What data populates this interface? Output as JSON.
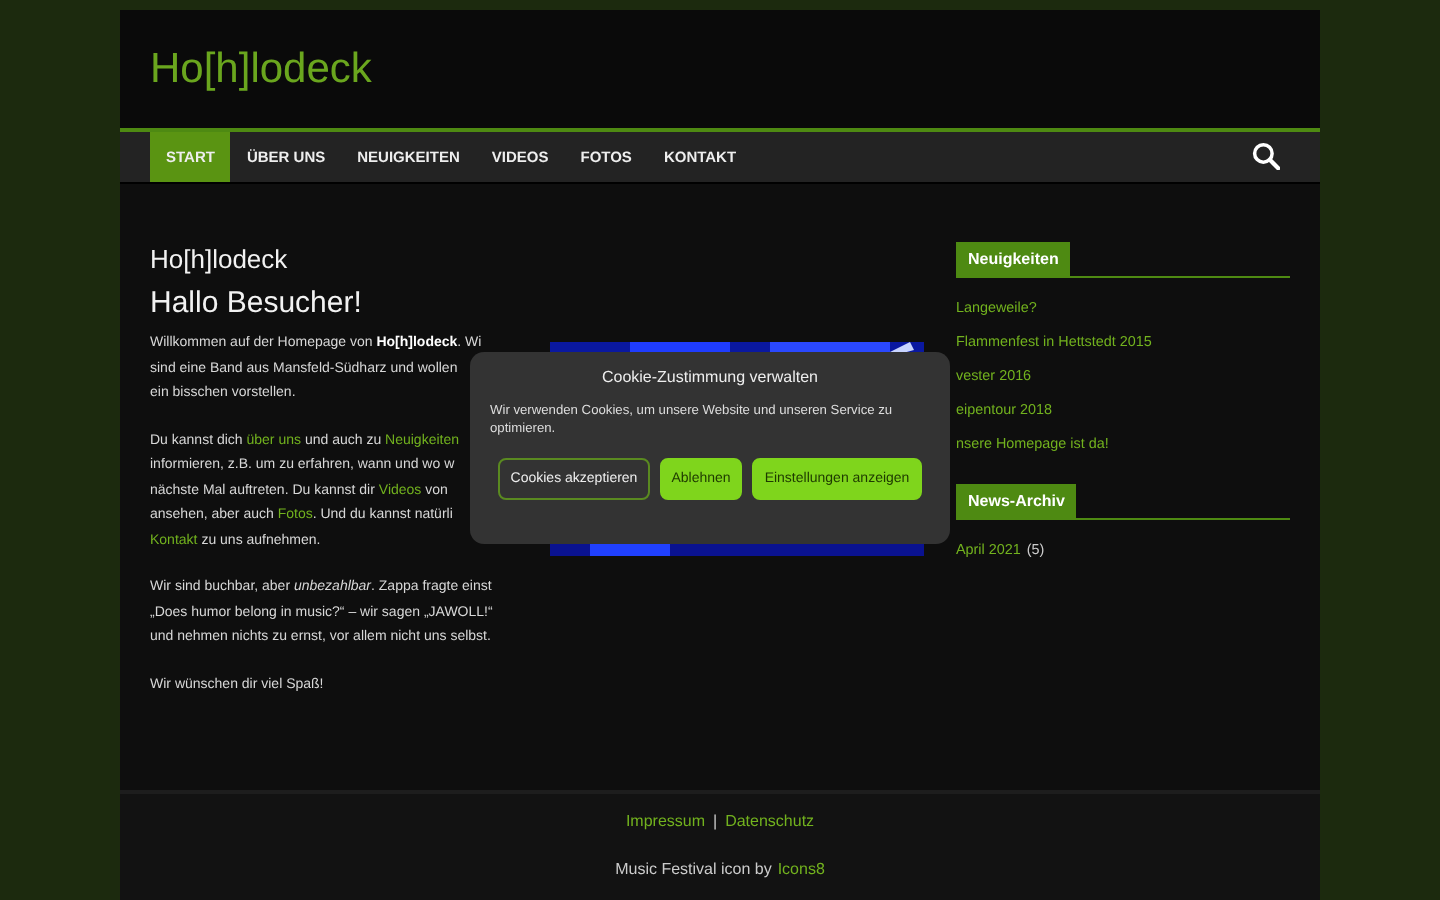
{
  "site_title": "Ho[h]lodeck",
  "nav": {
    "items": [
      {
        "label": "START",
        "selected": true
      },
      {
        "label": "ÜBER UNS",
        "selected": false
      },
      {
        "label": "NEUIGKEITEN",
        "selected": false
      },
      {
        "label": "VIDEOS",
        "selected": false
      },
      {
        "label": "FOTOS",
        "selected": false
      },
      {
        "label": "KONTAKT",
        "selected": false
      }
    ]
  },
  "page_title": "Ho[h]lodeck",
  "heading": "Hallo Besucher!",
  "paragraphs": [
    [
      [
        {
          "text": "Willkommen auf der Homepage von **Ho[h]lodeck**. Wi"
        }
      ],
      [
        {
          "text": "sind eine Band aus Mansfeld-Südharz und wollen"
        }
      ],
      [
        {
          "text": "ein bisschen vorstellen."
        }
      ]
    ],
    [
      [
        {
          "text": "Du kannst dich "
        },
        {
          "text": "über uns",
          "link": true
        },
        {
          "text": " und auch zu "
        },
        {
          "text": "Neuigkeiten",
          "link": true
        }
      ],
      [
        {
          "text": "informieren, z.B. um zu erfahren, wann und wo w"
        }
      ],
      [
        {
          "text": "nächste Mal auftreten. Du kannst dir "
        },
        {
          "text": "Videos",
          "link": true
        },
        {
          "text": " von"
        }
      ],
      [
        {
          "text": "ansehen, aber auch "
        },
        {
          "text": "Fotos",
          "link": true
        },
        {
          "text": ". Und du kannst natürli"
        }
      ],
      [
        {
          "text": "Kontakt",
          "link": true
        },
        {
          "text": " zu uns aufnehmen."
        }
      ]
    ],
    [
      [
        {
          "text": "Wir sind buchbar, aber *unbezahlbar*. Zappa fragte einst"
        }
      ],
      [
        {
          "text": "„Does humor belong in music?“ – wir sagen „JAWOLL!“"
        }
      ],
      [
        {
          "text": "und nehmen nichts zu ernst, vor allem nicht uns selbst."
        }
      ]
    ],
    [
      [
        {
          "text": "Wir wünschen dir viel Spaß!"
        }
      ]
    ]
  ],
  "sidebar": {
    "widgets": [
      {
        "title": "Neuigkeiten",
        "items": [
          {
            "label": "Langeweile?"
          },
          {
            "label": "Flammenfest in Hettstedt 2015"
          },
          {
            "label": "vester 2016"
          },
          {
            "label": "eipentour 2018"
          },
          {
            "label": "nsere Homepage ist da!"
          }
        ]
      },
      {
        "title": "News-Archiv",
        "items": [
          {
            "label": "April 2021",
            "count": "(5)"
          }
        ]
      }
    ]
  },
  "footer": {
    "links": [
      "Impressum",
      "Datenschutz"
    ],
    "separator": "|",
    "credit": "Music Festival icon by",
    "credit_link": "Icons8"
  },
  "cookie_dialog": {
    "title": "Cookie-Zustimmung verwalten",
    "text": "Wir verwenden Cookies, um unsere Website und unseren Service zu optimieren.",
    "buttons": [
      {
        "label": "Cookies akzeptieren",
        "kind": "outline"
      },
      {
        "label": "Ablehnen",
        "kind": "filled"
      },
      {
        "label": "Einstellungen anzeigen",
        "kind": "filled"
      }
    ]
  }
}
